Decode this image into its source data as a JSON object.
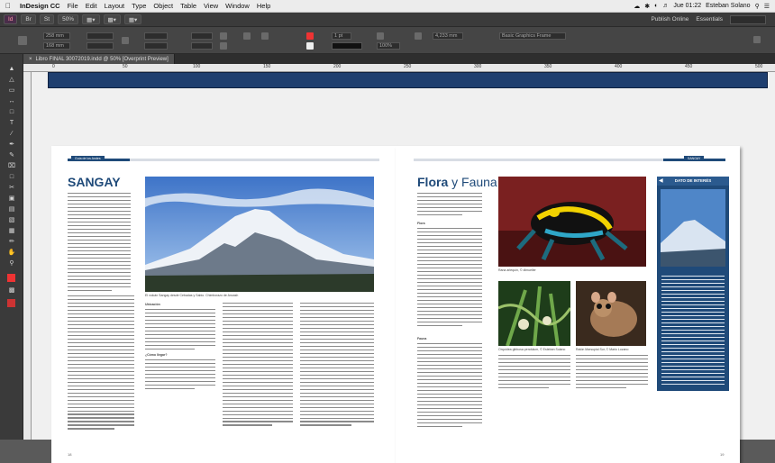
{
  "menubar": {
    "app": "InDesign CC",
    "items": [
      "File",
      "Edit",
      "Layout",
      "Type",
      "Object",
      "Table",
      "View",
      "Window",
      "Help"
    ],
    "time": "Jue 01:22",
    "user": "Esteban Solano"
  },
  "appbar": {
    "zoom": "50%",
    "publish": "Publish Online",
    "workspace": "Essentials"
  },
  "control": {
    "x_value": "258 mm",
    "y_value": "168 mm",
    "stroke_weight": "1 pt",
    "opacity": "100%",
    "width_value": "4,233 mm",
    "frame_style": "Basic Graphics Frame"
  },
  "document": {
    "tab_title": "Libro FINAL 30072019.indd @ 50% [Overprint Preview]",
    "ruler_marks": [
      "0",
      "50",
      "100",
      "150",
      "200",
      "250",
      "300",
      "350",
      "400",
      "450",
      "500"
    ]
  },
  "left_page": {
    "header_label": "Guía de los Andes",
    "title": "SANGAY",
    "photo_caption": "El volcán Sangay desde Cebadas y Sabio. Chimborazo de Ancash",
    "section1": "Ubicación",
    "section2": "¿Cómo llegar?",
    "page_number": "18"
  },
  "right_page": {
    "header_label": "SANGAY",
    "title_bold": "Flora",
    "title_rest": " y Fauna",
    "box_title": "DATO DE INTERÉS",
    "caption_frog": "Rana arlequín, © dlmueller",
    "caption_1": "Orquídea gibbosa pendulum, © Esteban Solano",
    "caption_2": "Ratón Marsupial Sur, © Mario Lozano",
    "section1": "Flora",
    "section2": "Fauna",
    "page_number": "19"
  },
  "colors": {
    "accent": "#1f4a79",
    "chrome": "#3b3b3b",
    "page_bg": "#ffffff"
  }
}
